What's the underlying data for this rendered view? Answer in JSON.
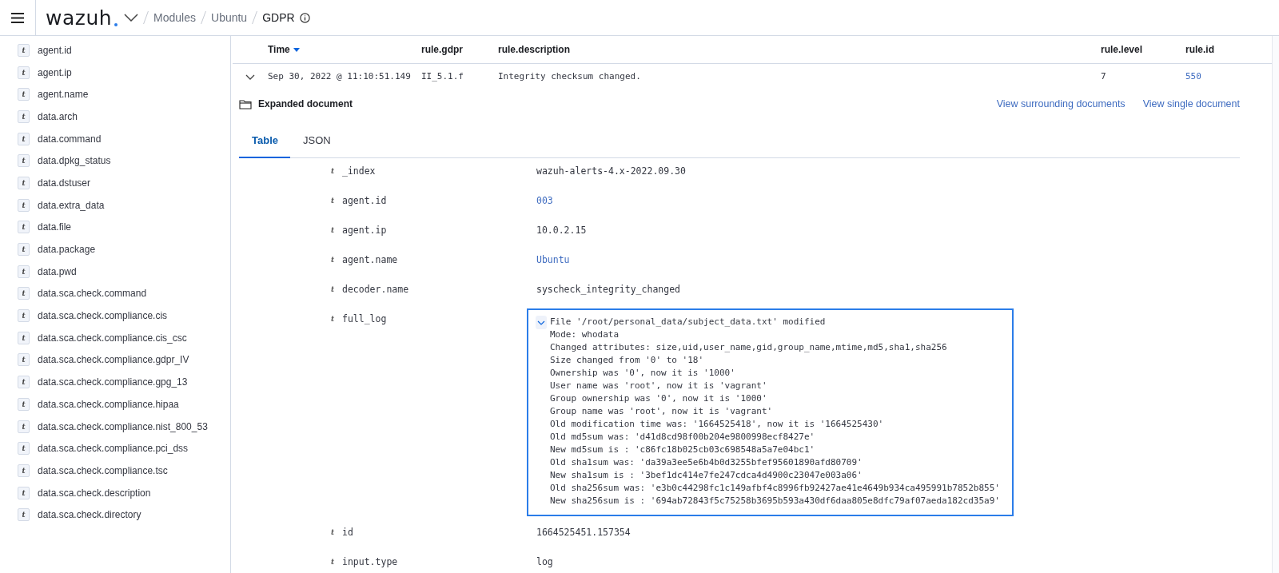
{
  "header": {
    "logo": "wazuh",
    "breadcrumbs": [
      {
        "label": "Modules",
        "current": false
      },
      {
        "label": "Ubuntu",
        "current": false
      },
      {
        "label": "GDPR",
        "current": true
      }
    ]
  },
  "sidebar": {
    "items": [
      {
        "type": "t",
        "label": "agent.id"
      },
      {
        "type": "t",
        "label": "agent.ip"
      },
      {
        "type": "t",
        "label": "agent.name"
      },
      {
        "type": "t",
        "label": "data.arch"
      },
      {
        "type": "t",
        "label": "data.command"
      },
      {
        "type": "t",
        "label": "data.dpkg_status"
      },
      {
        "type": "t",
        "label": "data.dstuser"
      },
      {
        "type": "t",
        "label": "data.extra_data"
      },
      {
        "type": "t",
        "label": "data.file"
      },
      {
        "type": "t",
        "label": "data.package"
      },
      {
        "type": "t",
        "label": "data.pwd"
      },
      {
        "type": "t",
        "label": "data.sca.check.command"
      },
      {
        "type": "t",
        "label": "data.sca.check.compliance.cis"
      },
      {
        "type": "t",
        "label": "data.sca.check.compliance.cis_csc"
      },
      {
        "type": "t",
        "label": "data.sca.check.compliance.gdpr_IV"
      },
      {
        "type": "t",
        "label": "data.sca.check.compliance.gpg_13"
      },
      {
        "type": "t",
        "label": "data.sca.check.compliance.hipaa"
      },
      {
        "type": "t",
        "label": "data.sca.check.compliance.nist_800_53"
      },
      {
        "type": "t",
        "label": "data.sca.check.compliance.pci_dss"
      },
      {
        "type": "t",
        "label": "data.sca.check.compliance.tsc"
      },
      {
        "type": "t",
        "label": "data.sca.check.description"
      },
      {
        "type": "t",
        "label": "data.sca.check.directory"
      }
    ]
  },
  "table": {
    "columns": [
      "Time",
      "rule.gdpr",
      "rule.description",
      "rule.level",
      "rule.id"
    ],
    "row": {
      "expanded": true,
      "time": "Sep 30, 2022 @ 11:10:51.149",
      "gdpr": "II_5.1.f",
      "description": "Integrity checksum changed.",
      "level": "7",
      "id": "550"
    }
  },
  "document": {
    "title": "Expanded document",
    "links": [
      "View surrounding documents",
      "View single document"
    ],
    "tabs": [
      {
        "label": "Table",
        "selected": true
      },
      {
        "label": "JSON",
        "selected": false
      }
    ],
    "fields": [
      {
        "type": "t",
        "name": "_index",
        "kind": "text",
        "value": "wazuh-alerts-4.x-2022.09.30"
      },
      {
        "type": "t",
        "name": "agent.id",
        "kind": "link",
        "value": "003"
      },
      {
        "type": "t",
        "name": "agent.ip",
        "kind": "text",
        "value": "10.0.2.15"
      },
      {
        "type": "t",
        "name": "agent.name",
        "kind": "link",
        "value": "Ubuntu"
      },
      {
        "type": "t",
        "name": "decoder.name",
        "kind": "text",
        "value": "syscheck_integrity_changed"
      },
      {
        "type": "t",
        "name": "full_log",
        "kind": "log",
        "expanded": true,
        "lines": [
          "File '/root/personal_data/subject_data.txt' modified",
          "Mode: whodata",
          "Changed attributes: size,uid,user_name,gid,group_name,mtime,md5,sha1,sha256",
          "Size changed from '0' to '18'",
          "Ownership was '0', now it is '1000'",
          "User name was 'root', now it is 'vagrant'",
          "Group ownership was '0', now it is '1000'",
          "Group name was 'root', now it is 'vagrant'",
          "Old modification time was: '1664525418', now it is '1664525430'",
          "Old md5sum was: 'd41d8cd98f00b204e9800998ecf8427e'",
          "New md5sum is : 'c86fc18b025cb03c698548a5a7e04bc1'",
          "Old sha1sum was: 'da39a3ee5e6b4b0d3255bfef95601890afd80709'",
          "New sha1sum is : '3bef1dc414e7fe247cdca4d4900c23047e003a06'",
          "Old sha256sum was: 'e3b0c44298fc1c149afbf4c8996fb92427ae41e4649b934ca495991b7852b855'",
          "New sha256sum is : '694ab72843f5c75258b3695b593a430df6daa805e8dfc79af07aeda182cd35a9'"
        ]
      },
      {
        "type": "t",
        "name": "id",
        "kind": "text",
        "value": "1664525451.157354"
      },
      {
        "type": "t",
        "name": "input.type",
        "kind": "text",
        "value": "log"
      }
    ]
  }
}
